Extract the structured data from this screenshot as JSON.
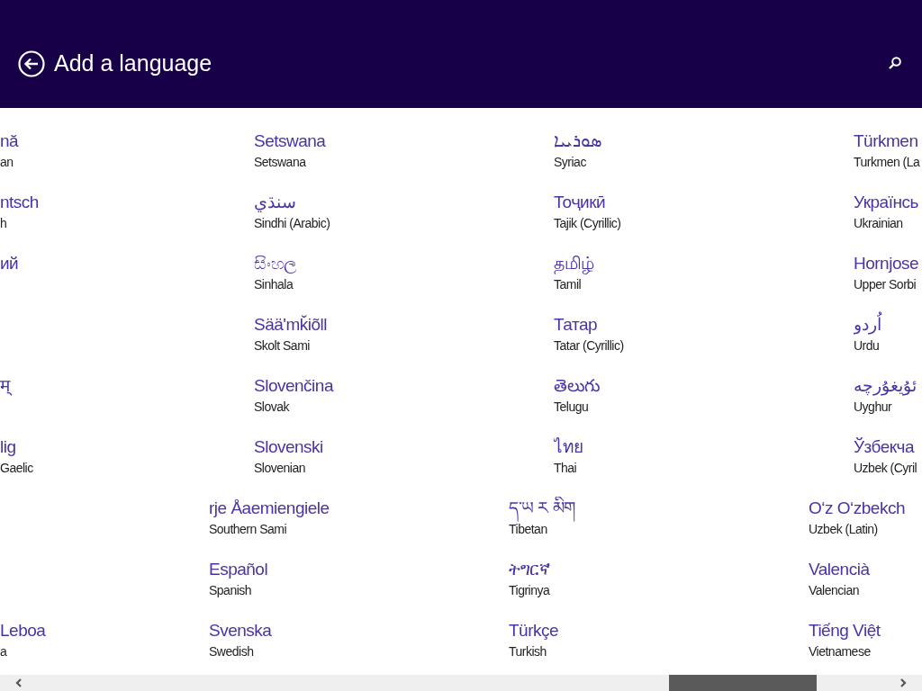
{
  "header": {
    "title": "Add a language"
  },
  "groups": [
    {
      "columns": [
        {
          "items": [
            {
              "kind": "language",
              "name": "nă",
              "english": "an"
            },
            {
              "kind": "language",
              "name": "ntsch",
              "english": "h"
            },
            {
              "kind": "language",
              "name": "ий"
            },
            {
              "kind": "gap"
            },
            {
              "kind": "language",
              "name": "म्"
            },
            {
              "kind": "language",
              "name": "lig",
              "english": "Gaelic"
            }
          ]
        },
        {
          "items": [
            {
              "kind": "language",
              "name": "Setswana",
              "english": "Setswana"
            },
            {
              "kind": "language",
              "name": "سنڌي",
              "english": "Sindhi (Arabic)"
            },
            {
              "kind": "language",
              "name": "සිංහල",
              "english": "Sinhala"
            },
            {
              "kind": "language",
              "name": "Sääʹmǩiõll",
              "english": "Skolt Sami"
            },
            {
              "kind": "language",
              "name": "Slovenčina",
              "english": "Slovak"
            },
            {
              "kind": "language",
              "name": "Slovenski",
              "english": "Slovenian"
            }
          ]
        },
        {
          "items": [
            {
              "kind": "language",
              "name": "ܣܘܪܝܝܐ",
              "english": "Syriac"
            },
            {
              "kind": "language",
              "name": "Тоҷикӣ",
              "english": "Tajik (Cyrillic)"
            },
            {
              "kind": "language",
              "name": "தமிழ்",
              "english": "Tamil"
            },
            {
              "kind": "language",
              "name": "Татар",
              "english": "Tatar (Cyrillic)"
            },
            {
              "kind": "language",
              "name": "తెలుగు",
              "english": "Telugu"
            },
            {
              "kind": "language",
              "name": "ไทย",
              "english": "Thai"
            }
          ]
        },
        {
          "items": [
            {
              "kind": "language",
              "name": "Türkmen",
              "english": "Turkmen (La"
            },
            {
              "kind": "language",
              "name": "Українсь",
              "english": "Ukrainian"
            },
            {
              "kind": "language",
              "name": "Hornjose",
              "english": "Upper Sorbi"
            },
            {
              "kind": "language",
              "name": "اُردو",
              "english": "Urdu"
            },
            {
              "kind": "language",
              "name": "ئۇيغۇرچە",
              "english": "Uyghur"
            },
            {
              "kind": "language",
              "name": "Ўзбекча",
              "english": "Uzbek (Cyril"
            }
          ]
        }
      ]
    },
    {
      "columns": [
        {
          "items": [
            {
              "kind": "gap"
            },
            {
              "kind": "gap"
            },
            {
              "kind": "language",
              "name": "Leboa",
              "english": "a"
            }
          ]
        },
        {
          "items": [
            {
              "kind": "language",
              "name": "rje Åaemiengiele",
              "english": "Southern Sami"
            },
            {
              "kind": "language",
              "name": "Español",
              "english": "Spanish"
            },
            {
              "kind": "language",
              "name": "Svenska",
              "english": "Swedish"
            }
          ]
        },
        {
          "items": [
            {
              "kind": "language",
              "name": "ད་ཡ  ཪ  མིག",
              "english": "Tibetan"
            },
            {
              "kind": "language",
              "name": "ትግርኛ",
              "english": "Tigrinya"
            },
            {
              "kind": "language",
              "name": "Türkçe",
              "english": "Turkish"
            }
          ]
        },
        {
          "items": [
            {
              "kind": "language",
              "name": "Oʻz   Oʻzbekch",
              "english": "Uzbek (Latin)"
            },
            {
              "kind": "language",
              "name": "Valencià",
              "english": "Valencian"
            },
            {
              "kind": "language",
              "name": "Tiếng Việt",
              "english": "Vietnamese"
            }
          ]
        }
      ]
    }
  ]
}
